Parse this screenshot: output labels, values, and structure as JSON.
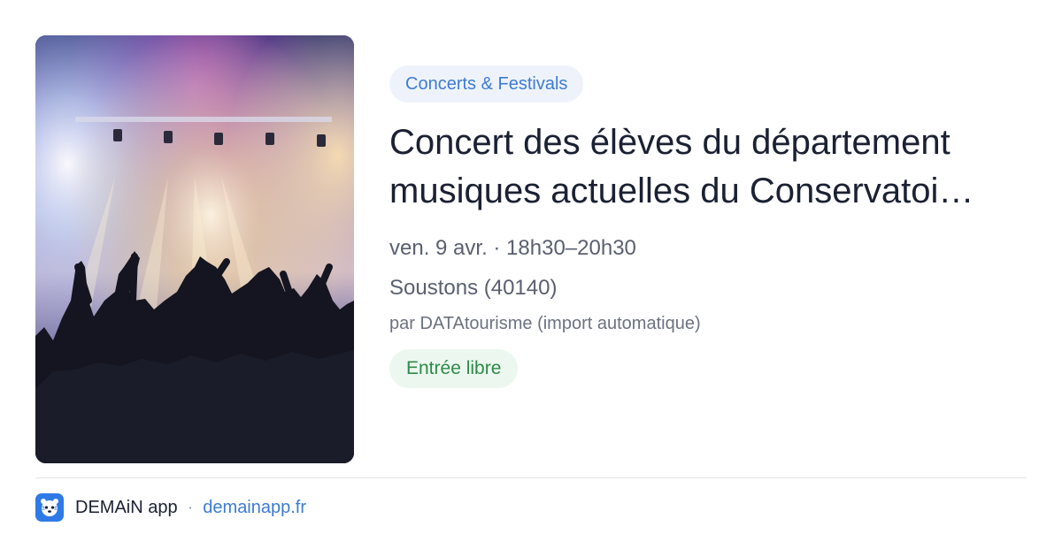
{
  "event": {
    "image_alt": "Foule de concert devant une scène éclairée",
    "category": "Concerts & Festivals",
    "title": "Concert des élèves du département musiques actuelles du Conservatoi…",
    "datetime": "ven. 9 avr. · 18h30–20h30",
    "location": "Soustons (40140)",
    "source": "par DATAtourisme (import automatique)",
    "price_badge": "Entrée libre"
  },
  "footer": {
    "app_name": "DEMAiN app",
    "separator": "·",
    "domain": "demainapp.fr",
    "icon": "demain-app-icon"
  },
  "colors": {
    "accent": "#3d7bd5",
    "category_bg": "#eef3fb",
    "badge_text": "#2f8a48",
    "badge_bg": "#ecf8ef",
    "title": "#1b2133",
    "app_icon_bg": "#2f7ae6"
  }
}
